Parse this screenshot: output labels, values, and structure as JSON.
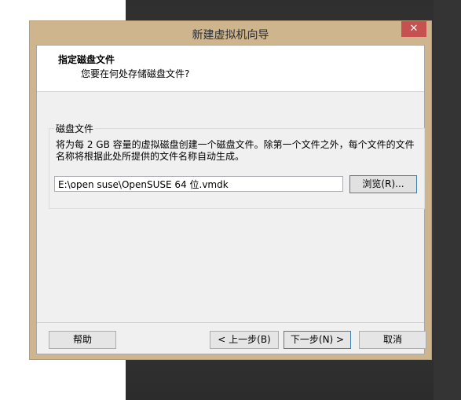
{
  "window": {
    "title": "新建虚拟机向导",
    "close_glyph": "✕"
  },
  "header": {
    "title": "指定磁盘文件",
    "subtitle": "您要在何处存储磁盘文件?"
  },
  "disk_file_group": {
    "label": "磁盘文件",
    "description": "将为每 2 GB 容量的虚拟磁盘创建一个磁盘文件。除第一个文件之外，每个文件的文件名称将根据此处所提供的文件名称自动生成。",
    "path_value": "E:\\open suse\\OpenSUSE 64 位.vmdk",
    "browse_label": "浏览(R)..."
  },
  "footer": {
    "help_label": "帮助",
    "back_label": "< 上一步(B)",
    "next_label": "下一步(N) >",
    "cancel_label": "取消"
  }
}
